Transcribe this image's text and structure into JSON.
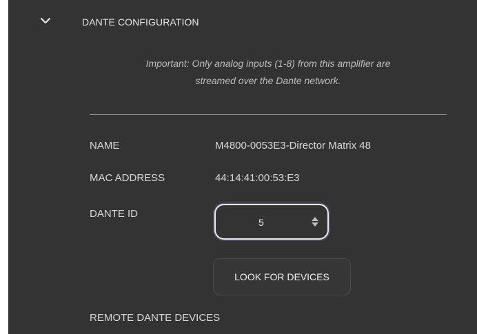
{
  "section": {
    "title": "DANTE CONFIGURATION",
    "chevron_icon": "chevron-down-icon"
  },
  "notice": {
    "line1": "Important: Only analog inputs (1-8) from this amplifier are",
    "line2": "streamed over the Dante network."
  },
  "fields": {
    "name_label": "NAME",
    "name_value": "M4800-0053E3-Director Matrix 48",
    "mac_label": "MAC ADDRESS",
    "mac_value": "44:14:41:00:53:E3",
    "dante_id_label": "DANTE ID",
    "dante_id_value": "5",
    "stepper_icon": "up-down-arrows-icon"
  },
  "actions": {
    "look_for_devices": "LOOK FOR DEVICES"
  },
  "remote": {
    "label": "REMOTE DANTE DEVICES"
  },
  "colors": {
    "panel_background": "#333333",
    "text": "#d8d8d8",
    "muted_text": "#bdbdbd",
    "divider": "#9a9a9a",
    "stepper_border": "#ebebeb"
  }
}
